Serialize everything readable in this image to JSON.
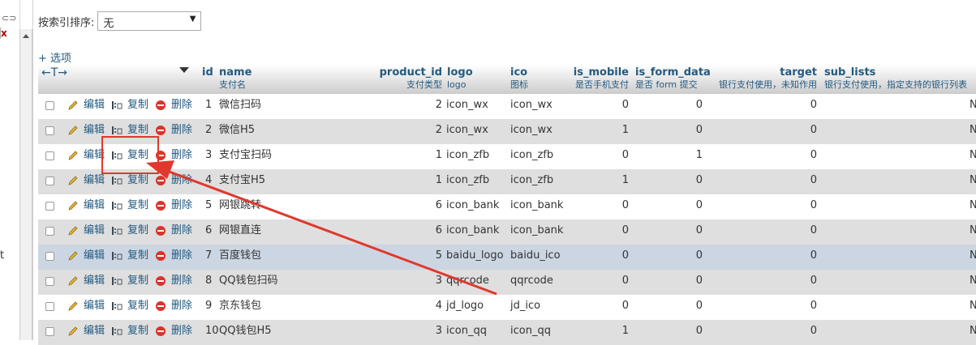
{
  "left": {
    "link_glyph": "⊂⊃",
    "close_glyph": "x",
    "partial_text": "t"
  },
  "sort": {
    "label": "按索引排序:",
    "selected": "无"
  },
  "options_link": "+ 选项",
  "columns": [
    {
      "name": "id",
      "comment": ""
    },
    {
      "name": "name",
      "comment": "支付名"
    },
    {
      "name": "product_id",
      "comment": "支付类型"
    },
    {
      "name": "logo",
      "comment": "logo"
    },
    {
      "name": "ico",
      "comment": "图标"
    },
    {
      "name": "is_mobile",
      "comment": "是否手机支付"
    },
    {
      "name": "is_form_data",
      "comment": "是否 form 提交"
    },
    {
      "name": "target",
      "comment": "银行支付使用，未知作用"
    },
    {
      "name": "sub_lists",
      "comment": "银行支付使用，指定支持的银行列表"
    }
  ],
  "actions": {
    "edit": "编辑",
    "copy": "复制",
    "delete": "删除"
  },
  "rows": [
    {
      "id": "1",
      "name": "微信扫码",
      "product_id": "2",
      "logo": "icon_wx",
      "ico": "icon_wx",
      "is_mobile": "0",
      "is_form_data": "0",
      "target": "0",
      "sub_lists": "N"
    },
    {
      "id": "2",
      "name": "微信H5",
      "product_id": "2",
      "logo": "icon_wx",
      "ico": "icon_wx",
      "is_mobile": "1",
      "is_form_data": "0",
      "target": "0",
      "sub_lists": "N"
    },
    {
      "id": "3",
      "name": "支付宝扫码",
      "product_id": "1",
      "logo": "icon_zfb",
      "ico": "icon_zfb",
      "is_mobile": "0",
      "is_form_data": "1",
      "target": "0",
      "sub_lists": "N"
    },
    {
      "id": "4",
      "name": "支付宝H5",
      "product_id": "1",
      "logo": "icon_zfb",
      "ico": "icon_zfb",
      "is_mobile": "1",
      "is_form_data": "0",
      "target": "0",
      "sub_lists": "N"
    },
    {
      "id": "5",
      "name": "网银跳转",
      "product_id": "6",
      "logo": "icon_bank",
      "ico": "icon_bank",
      "is_mobile": "0",
      "is_form_data": "0",
      "target": "0",
      "sub_lists": "N"
    },
    {
      "id": "6",
      "name": "网银直连",
      "product_id": "6",
      "logo": "icon_bank",
      "ico": "icon_bank",
      "is_mobile": "0",
      "is_form_data": "0",
      "target": "0",
      "sub_lists": "N"
    },
    {
      "id": "7",
      "name": "百度钱包",
      "product_id": "5",
      "logo": "baidu_logo",
      "ico": "baidu_ico",
      "is_mobile": "0",
      "is_form_data": "0",
      "target": "0",
      "sub_lists": "N"
    },
    {
      "id": "8",
      "name": "QQ钱包扫码",
      "product_id": "3",
      "logo": "qqrcode",
      "ico": "qqrcode",
      "is_mobile": "0",
      "is_form_data": "0",
      "target": "0",
      "sub_lists": "N"
    },
    {
      "id": "9",
      "name": "京东钱包",
      "product_id": "4",
      "logo": "jd_logo",
      "ico": "jd_ico",
      "is_mobile": "0",
      "is_form_data": "0",
      "target": "0",
      "sub_lists": "N"
    },
    {
      "id": "10",
      "name": "QQ钱包H5",
      "product_id": "3",
      "logo": "icon_qq",
      "ico": "icon_qq",
      "is_mobile": "1",
      "is_form_data": "0",
      "target": "0",
      "sub_lists": "N"
    }
  ],
  "colors": {
    "link": "#235a81",
    "annotation": "#e0382e",
    "row_alt": "#dfdfdf",
    "row_highlight": "#ccd6e2"
  }
}
